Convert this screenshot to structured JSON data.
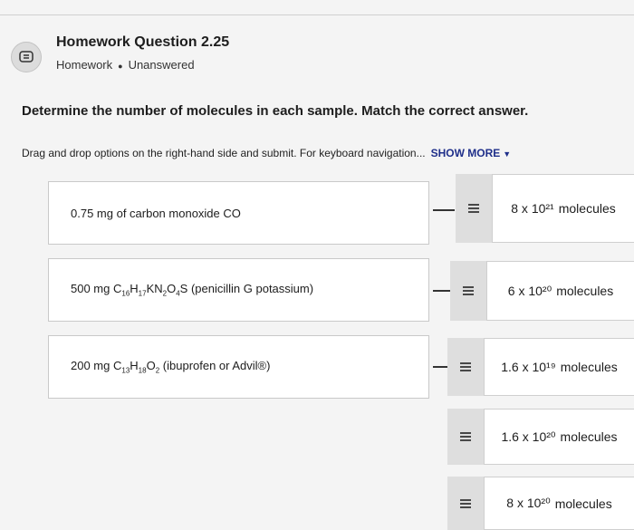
{
  "header": {
    "title": "Homework Question 2.25",
    "category": "Homework",
    "status": "Unanswered",
    "icon": "question-bubble-icon"
  },
  "question": {
    "prompt": "Determine the number of molecules in each sample. Match the correct answer.",
    "instructions": "Drag and drop options on the right-hand side and submit. For keyboard navigation...",
    "show_more": "SHOW MORE"
  },
  "items": [
    {
      "text": "0.75 mg of carbon monoxide CO"
    },
    {
      "pre": "500 mg C",
      "s1": "16",
      "m1": "H",
      "s2": "17",
      "m2": "KN",
      "s3": "2",
      "m3": "O",
      "s4": "4",
      "post": "S (penicillin G potassium)"
    },
    {
      "pre": "200 mg C",
      "s1": "13",
      "m1": "H",
      "s2": "18",
      "m2": "O",
      "s3": "2",
      "post": "(ibuprofen or Advil®)"
    }
  ],
  "answers": [
    {
      "value": "8 x 10²¹",
      "unit": "molecules"
    },
    {
      "value": "6 x 10²⁰",
      "unit": "molecules"
    },
    {
      "value": "1.6 x 10¹⁹",
      "unit": "molecules"
    },
    {
      "value": "1.6 x 10²⁰",
      "unit": "molecules"
    },
    {
      "value": "8 x 10²⁰",
      "unit": "molecules"
    }
  ]
}
